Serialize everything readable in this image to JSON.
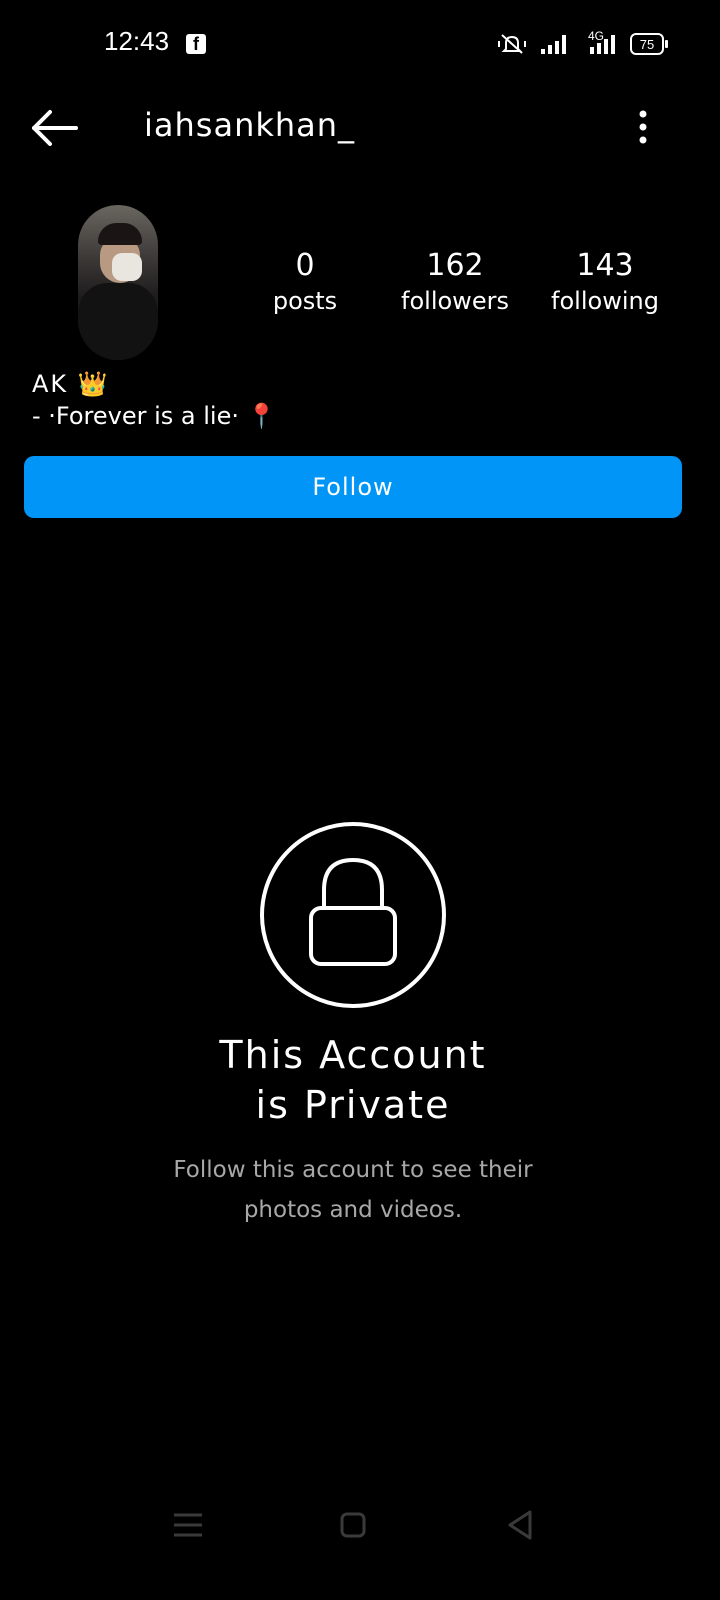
{
  "status_bar": {
    "time": "12:43",
    "app_icon": "facebook-icon",
    "network_label": "4G",
    "battery": "75"
  },
  "header": {
    "username": "iahsankhan_",
    "back_icon": "back-arrow-icon",
    "more_icon": "more-vertical-icon"
  },
  "profile": {
    "stats": [
      {
        "value": "0",
        "label": "posts"
      },
      {
        "value": "162",
        "label": "followers"
      },
      {
        "value": "143",
        "label": "following"
      }
    ],
    "name": "AK 👑",
    "bio": "- ·Forever is a lie· 📍",
    "follow_label": "Follow"
  },
  "private": {
    "title_line1": "This Account",
    "title_line2": "is Private",
    "subtitle_line1": "Follow this account to see their",
    "subtitle_line2": "photos and videos."
  },
  "colors": {
    "background": "#000000",
    "accent": "#0095f6",
    "secondary_text": "#a8a8a8"
  }
}
